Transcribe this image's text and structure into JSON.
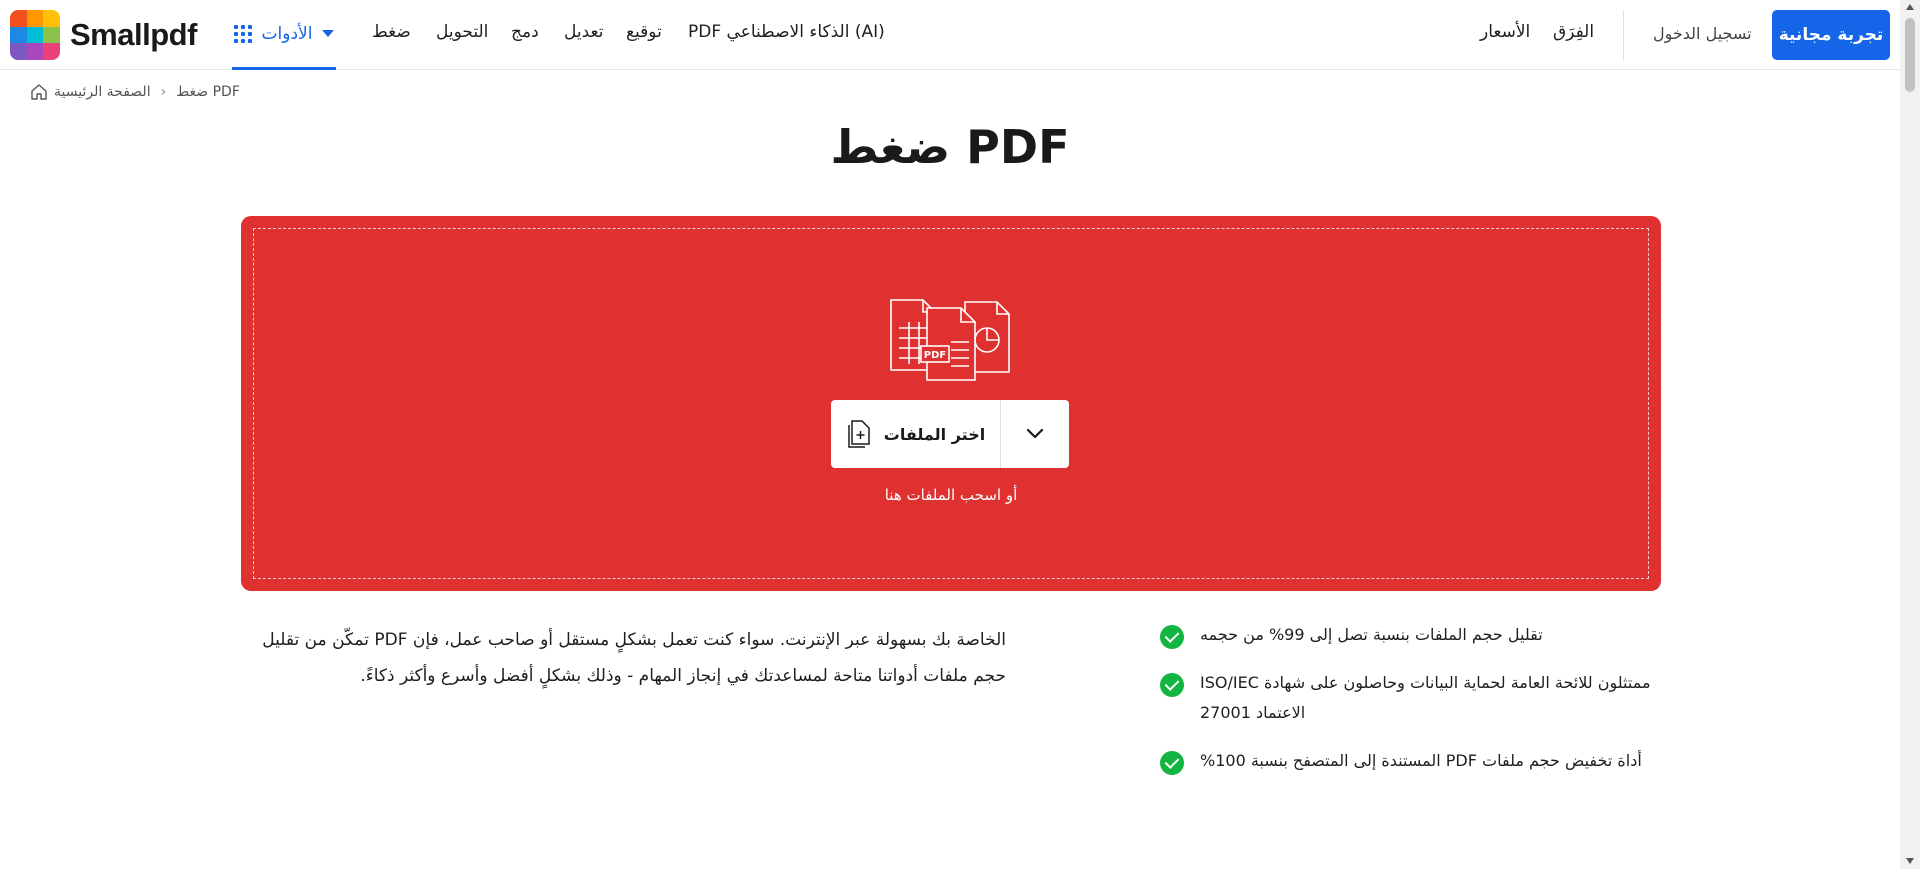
{
  "brand": {
    "name": "Smallpdf",
    "logo_colors": [
      "#f5511e",
      "#ffb300",
      "#1e88e5",
      "#00acc1",
      "#7cb342",
      "#43a047",
      "#8e24aa",
      "#d81b60",
      "#ec407a"
    ]
  },
  "header": {
    "tools_label": "الأدوات",
    "nav": [
      "ضغط",
      "التحويل",
      "دمج",
      "تعديل",
      "توقيع",
      "PDF الذكاء الاصطناعي (AI)"
    ],
    "teams_label": "الفِرَق",
    "pricing_label": "الأسعار",
    "login_label": "تسجيل الدخول",
    "trial_label": "تجربة مجانية",
    "accent": "#1565e8"
  },
  "breadcrumb": {
    "home": "الصفحة الرئيسية",
    "separator": "›",
    "current": "ضغط PDF"
  },
  "page": {
    "title": "ضغط PDF"
  },
  "dropzone": {
    "choose_label": "اختر الملفات",
    "hint": "أو اسحب الملفات هنا",
    "pdf_tag": "PDF",
    "color": "#e03131"
  },
  "description": "الخاصة بك بسهولة عبر الإنترنت. سواء كنت تعمل بشكلٍ مستقل أو صاحب عمل، فإن PDF تمكّن من تقليل حجم ملفات أدواتنا متاحة لمساعدتك في إنجاز المهام - وذلك بشكلٍ أفضل وأسرع وأكثر ذكاءً.",
  "features": [
    "تقليل حجم الملفات بنسبة تصل إلى 99% من حجمه",
    "ISO/IEC ممتثلون للائحة العامة لحماية البيانات وحاصلون على شهادة الاعتماد 27001",
    "%المستندة إلى المتصفح بنسبة 100 PDF أداة تخفيض حجم ملفات"
  ]
}
